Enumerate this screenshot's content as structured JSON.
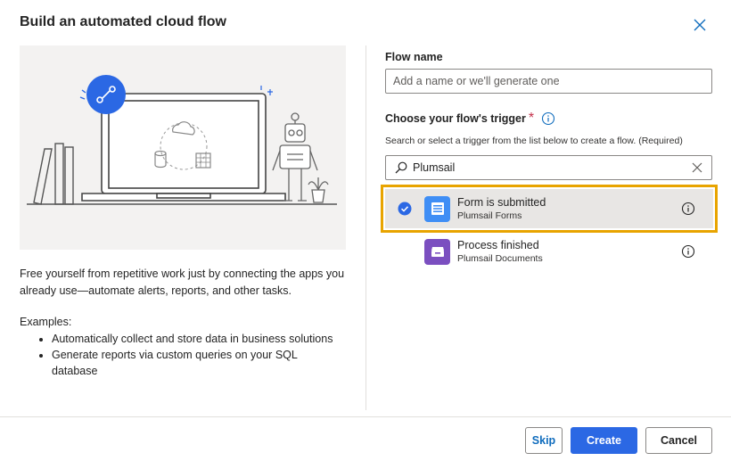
{
  "dialog": {
    "title": "Build an automated cloud flow"
  },
  "left": {
    "description": "Free yourself from repetitive work just by connecting the apps you already use—automate alerts, reports, and other tasks.",
    "examples_label": "Examples:",
    "examples": [
      "Automatically collect and store data in business solutions",
      "Generate reports via custom queries on your SQL database"
    ]
  },
  "flow_name": {
    "label": "Flow name",
    "value": "",
    "placeholder": "Add a name or we'll generate one"
  },
  "trigger": {
    "label": "Choose your flow's trigger",
    "required_mark": "*",
    "helper": "Search or select a trigger from the list below to create a flow. (Required)",
    "search_value": "Plumsail",
    "items": [
      {
        "title": "Form is submitted",
        "connector": "Plumsail Forms",
        "icon": "form-list-icon",
        "tile_color": "#3f8ef5",
        "selected": true
      },
      {
        "title": "Process finished",
        "connector": "Plumsail Documents",
        "icon": "document-box-icon",
        "tile_color": "#7b4fc0",
        "selected": false
      }
    ]
  },
  "footer": {
    "skip_label": "Skip",
    "create_label": "Create",
    "cancel_label": "Cancel"
  },
  "colors": {
    "accent": "#2b68e4",
    "selection_outline": "#e8a400",
    "selected_bg": "#e8e6e4",
    "hero_bg": "#f3f2f1"
  }
}
